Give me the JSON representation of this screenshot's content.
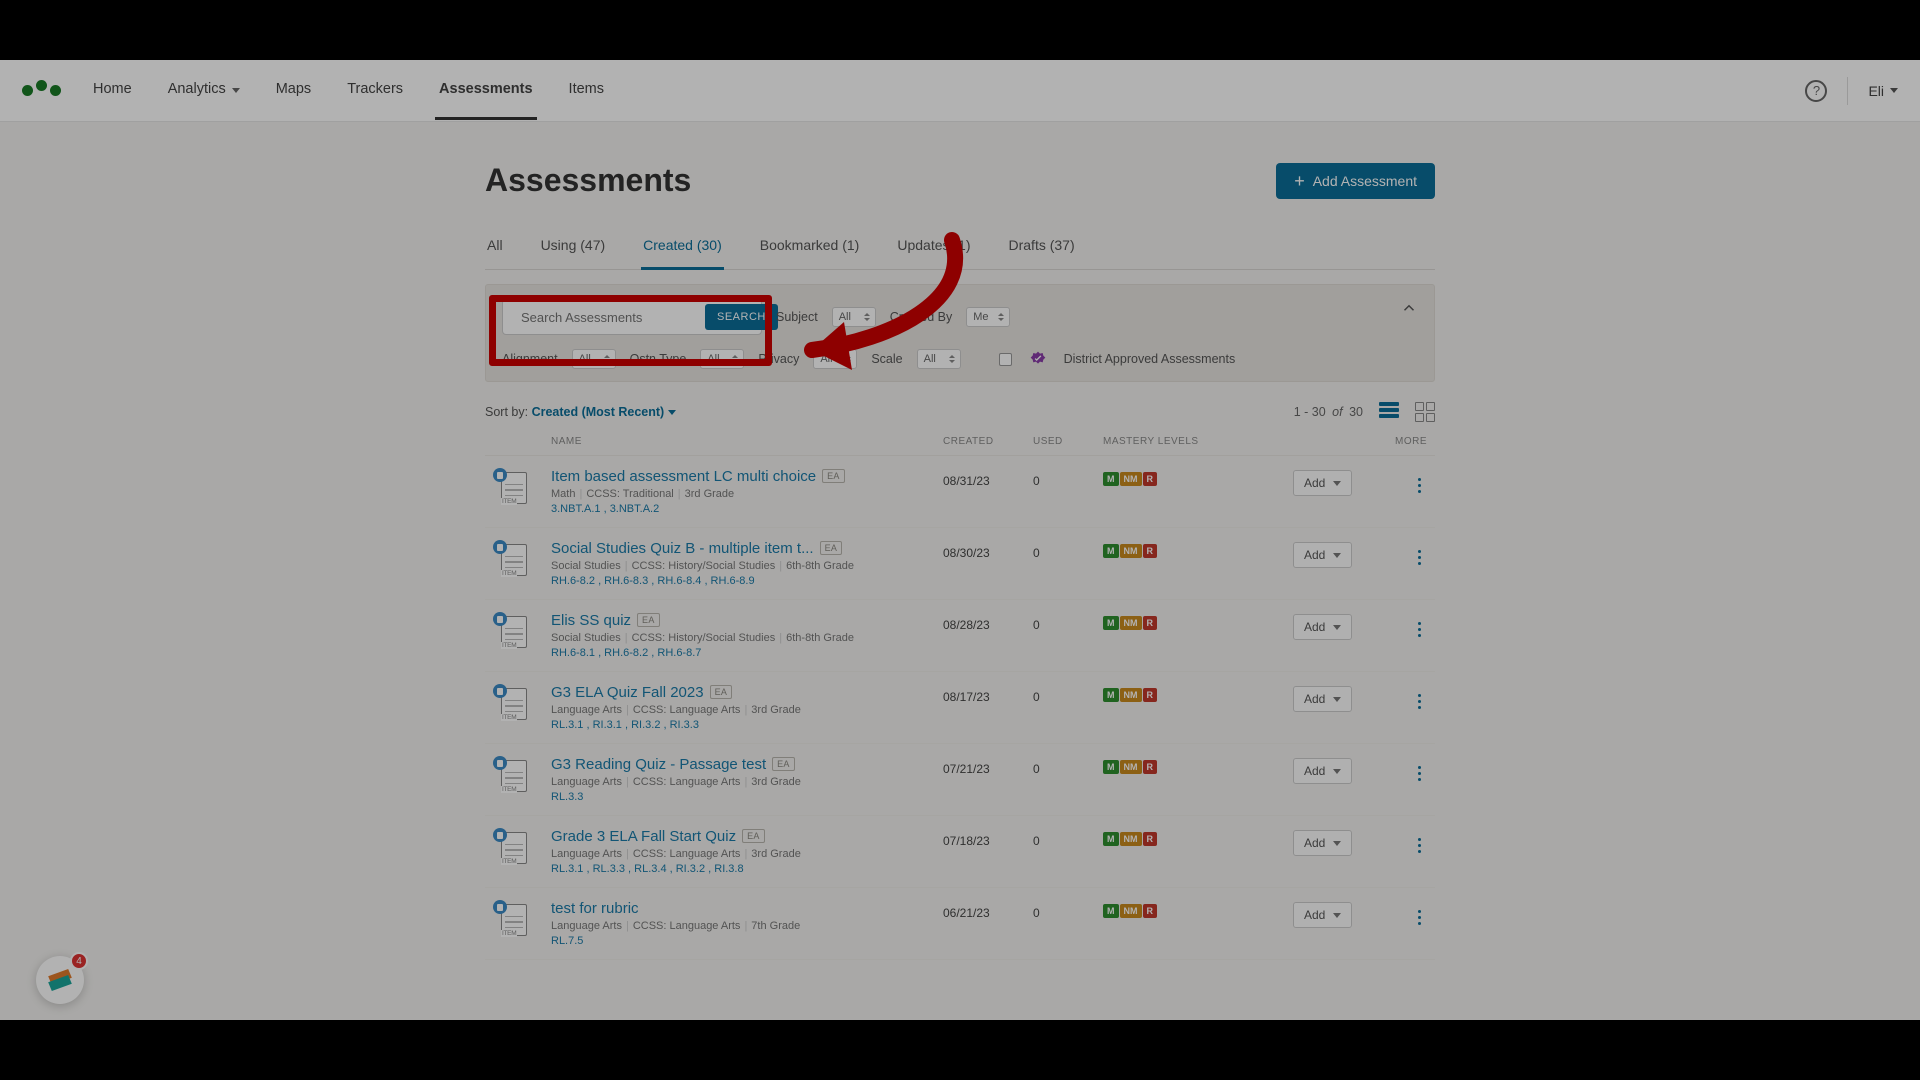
{
  "nav": {
    "items": [
      "Home",
      "Analytics",
      "Maps",
      "Trackers",
      "Assessments",
      "Items"
    ],
    "active_index": 4,
    "caret_indices": [
      1
    ],
    "user": "Eli",
    "help_glyph": "?"
  },
  "page": {
    "title": "Assessments",
    "add_label": "Add Assessment"
  },
  "tabs": [
    {
      "label": "All"
    },
    {
      "label": "Using (47)"
    },
    {
      "label": "Created (30)",
      "active": true
    },
    {
      "label": "Bookmarked (1)"
    },
    {
      "label": "Updates (1)"
    },
    {
      "label": "Drafts (37)"
    }
  ],
  "filters": {
    "search_placeholder": "Search Assessments",
    "search_button": "SEARCH",
    "row1": [
      {
        "label": "Subject",
        "value": "All"
      },
      {
        "label": "Created By",
        "value": "Me"
      }
    ],
    "row2": [
      {
        "label": "Alignment",
        "value": "All"
      },
      {
        "label": "Qstn Type",
        "value": "All"
      },
      {
        "label": "Privacy",
        "value": "All"
      },
      {
        "label": "Scale",
        "value": "All"
      }
    ],
    "district_label": "District Approved Assessments"
  },
  "sort": {
    "prefix": "Sort by:",
    "value": "Created (Most Recent)",
    "range": "1 - 30",
    "of_label": "of",
    "total": "30"
  },
  "columns": {
    "name": "NAME",
    "created": "CREATED",
    "used": "USED",
    "ml": "MASTERY LEVELS",
    "more": "MORE"
  },
  "mastery": [
    "M",
    "NM",
    "R"
  ],
  "add_btn": "Add",
  "rows": [
    {
      "title": "Item based assessment LC multi choice",
      "badge": "EA",
      "subject": "Math",
      "align": "CCSS: Traditional",
      "grade": "3rd Grade",
      "standards": "3.NBT.A.1 , 3.NBT.A.2",
      "created": "08/31/23",
      "used": "0"
    },
    {
      "title": "Social Studies Quiz B - multiple item t...",
      "badge": "EA",
      "subject": "Social Studies",
      "align": "CCSS: History/Social Studies",
      "grade": "6th-8th Grade",
      "standards": "RH.6-8.2 , RH.6-8.3 , RH.6-8.4 , RH.6-8.9",
      "created": "08/30/23",
      "used": "0"
    },
    {
      "title": "Elis SS quiz",
      "badge": "EA",
      "subject": "Social Studies",
      "align": "CCSS: History/Social Studies",
      "grade": "6th-8th Grade",
      "standards": "RH.6-8.1 , RH.6-8.2 , RH.6-8.7",
      "created": "08/28/23",
      "used": "0"
    },
    {
      "title": "G3 ELA Quiz Fall 2023",
      "badge": "EA",
      "subject": "Language Arts",
      "align": "CCSS: Language Arts",
      "grade": "3rd Grade",
      "standards": "RL.3.1 , RI.3.1 , RI.3.2 , RI.3.3",
      "created": "08/17/23",
      "used": "0"
    },
    {
      "title": "G3 Reading Quiz - Passage test",
      "badge": "EA",
      "subject": "Language Arts",
      "align": "CCSS: Language Arts",
      "grade": "3rd Grade",
      "standards": "RL.3.3",
      "created": "07/21/23",
      "used": "0"
    },
    {
      "title": "Grade 3 ELA Fall Start Quiz",
      "badge": "EA",
      "subject": "Language Arts",
      "align": "CCSS: Language Arts",
      "grade": "3rd Grade",
      "standards": "RL.3.1 , RL.3.3 , RL.3.4 , RI.3.2 , RI.3.8",
      "created": "07/18/23",
      "used": "0"
    },
    {
      "title": "test for rubric",
      "badge": "",
      "subject": "Language Arts",
      "align": "CCSS: Language Arts",
      "grade": "7th Grade",
      "standards": "RL.7.5",
      "created": "06/21/23",
      "used": "0"
    }
  ],
  "help_widget": {
    "count": "4"
  }
}
